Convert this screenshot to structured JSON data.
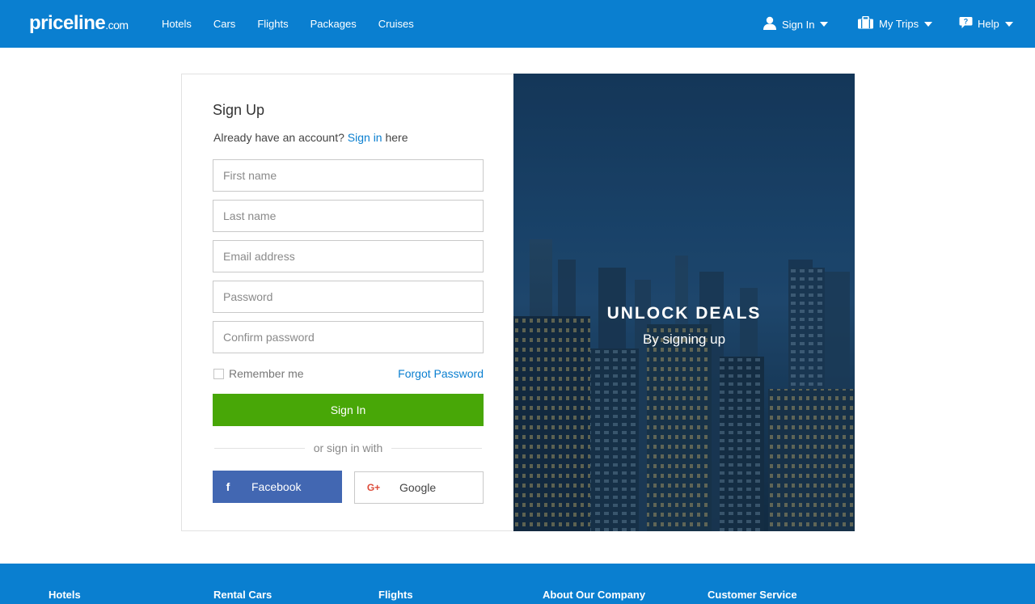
{
  "header": {
    "logo_main": "priceline",
    "logo_suffix": ".com",
    "nav": [
      "Hotels",
      "Cars",
      "Flights",
      "Packages",
      "Cruises"
    ],
    "sign_in": "Sign In",
    "my_trips": "My Trips",
    "help": "Help"
  },
  "form": {
    "title": "Sign Up",
    "already_prefix": "Already have an account?",
    "already_link": "Sign in",
    "already_suffix": "here",
    "first_name_placeholder": "First name",
    "last_name_placeholder": "Last name",
    "email_placeholder": "Email address",
    "password_placeholder": "Password",
    "confirm_password_placeholder": "Confirm password",
    "remember_me": "Remember me",
    "forgot_password": "Forgot Password",
    "sign_in_button": "Sign In",
    "or_sign_in_with": "or sign in with",
    "facebook": "Facebook",
    "google": "Google",
    "facebook_icon_glyph": "f",
    "google_icon_glyph": "G+"
  },
  "promo": {
    "title": "UNLOCK DEALS",
    "subtitle": "By signing up"
  },
  "footer": {
    "columns": [
      "Hotels",
      "Rental Cars",
      "Flights",
      "About Our Company",
      "Customer Service"
    ]
  },
  "colors": {
    "brand_blue": "#0a7fd0",
    "green_button": "#48a707",
    "facebook_blue": "#4267b2",
    "google_red": "#dd4b39"
  }
}
